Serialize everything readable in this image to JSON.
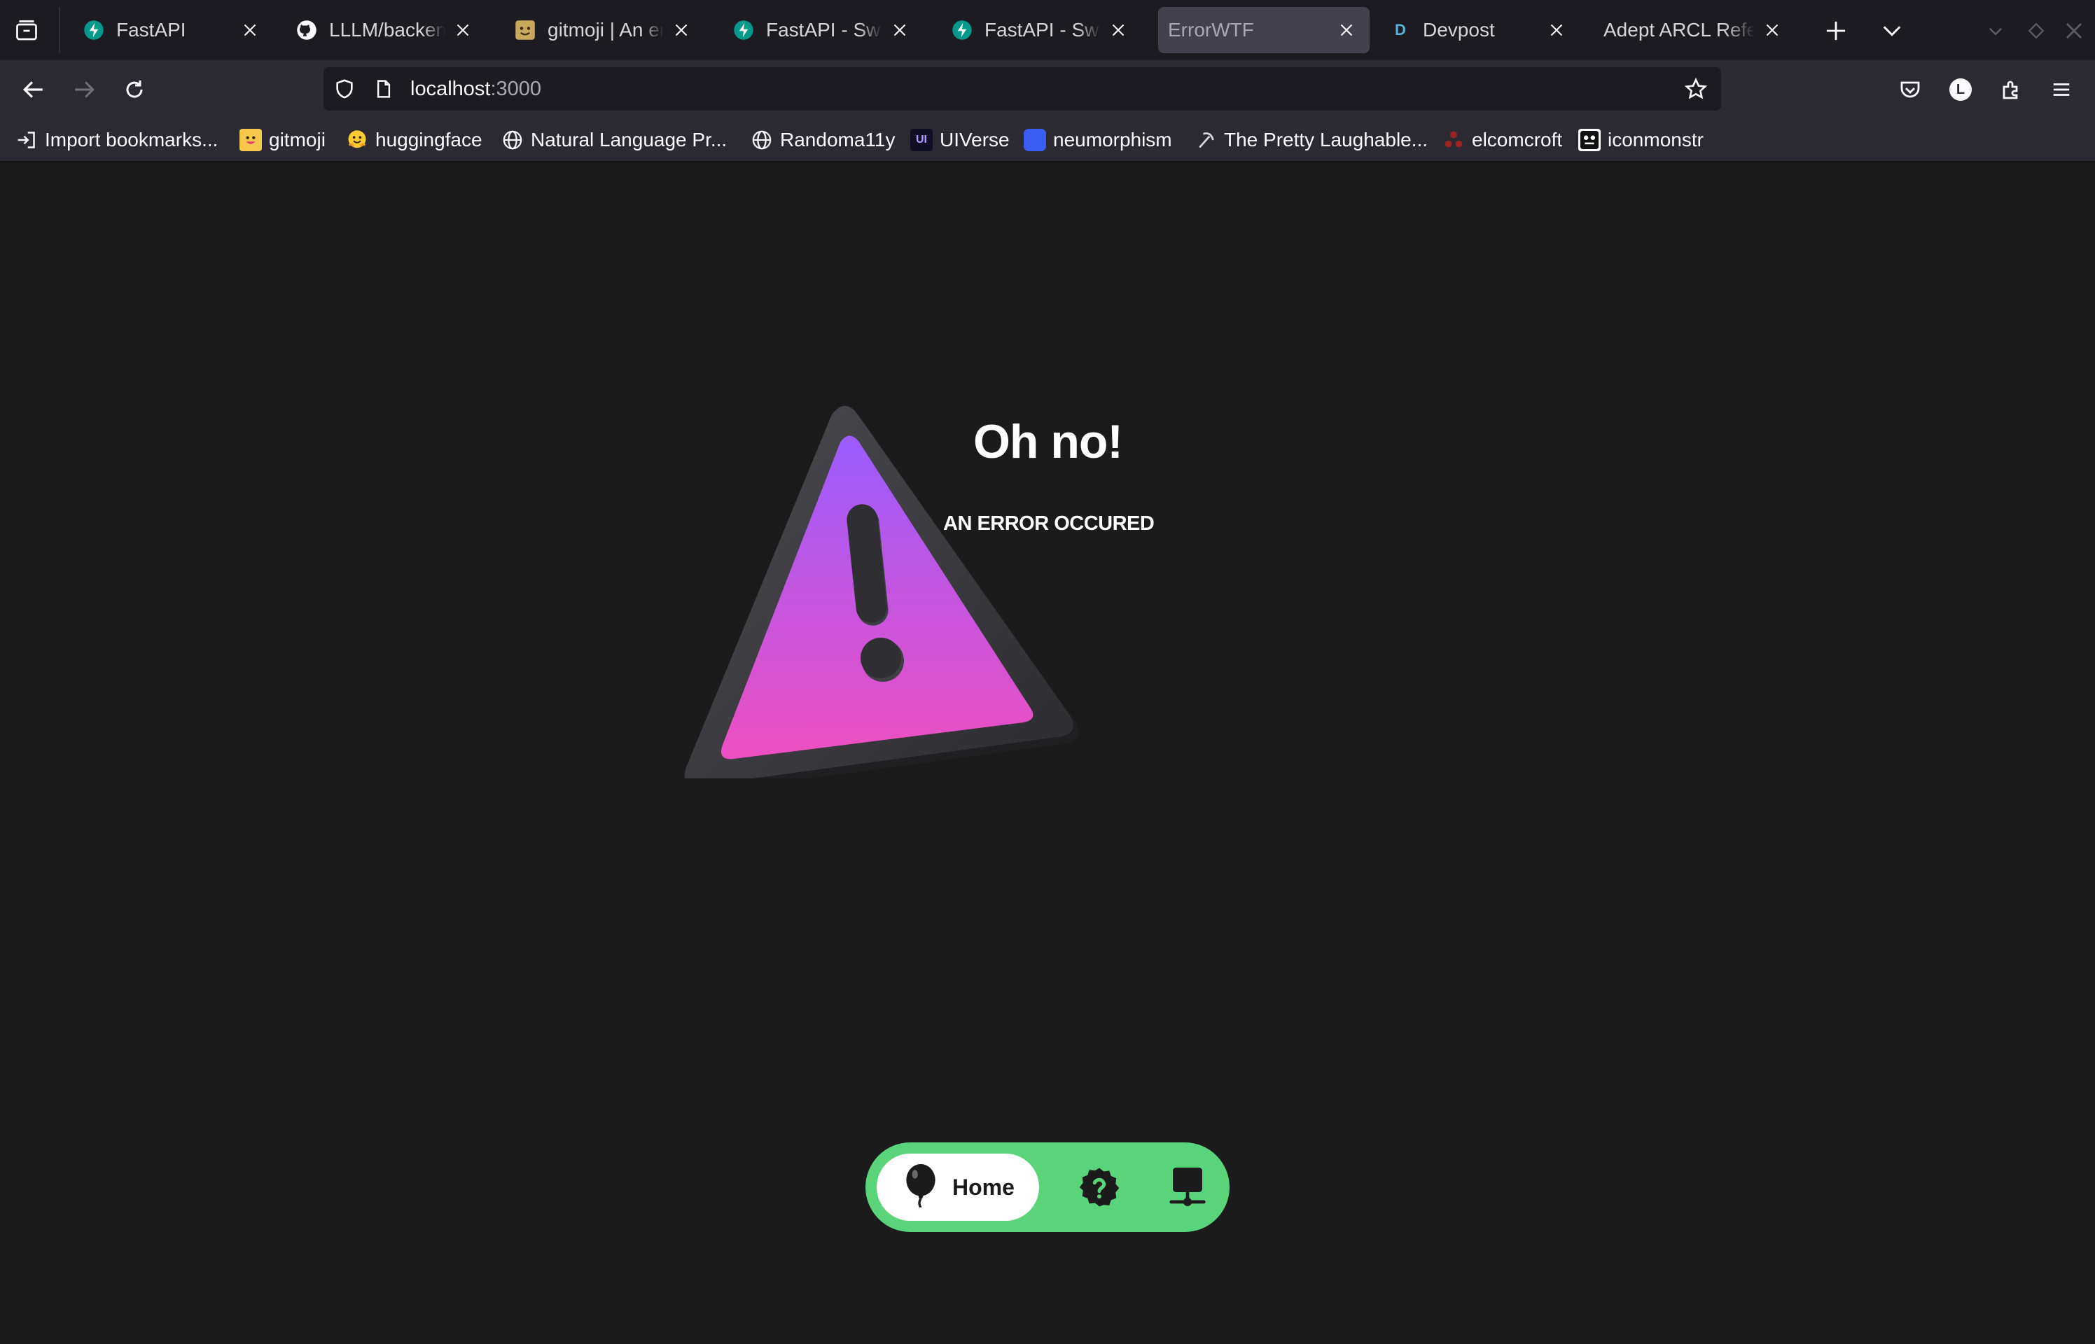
{
  "browser": {
    "tabs": [
      {
        "title": "FastAPI",
        "favicon": "fastapi-icon",
        "active": false
      },
      {
        "title": "LLLM/backend at main",
        "favicon": "github-icon",
        "active": false
      },
      {
        "title": "gitmoji | An emoji guide",
        "favicon": "gitmoji-icon",
        "active": false
      },
      {
        "title": "FastAPI - Swagger UI",
        "favicon": "fastapi-icon",
        "active": false
      },
      {
        "title": "FastAPI - Swagger UI",
        "favicon": "fastapi-icon",
        "active": false
      },
      {
        "title": "ErrorWTF",
        "favicon": "",
        "active": true
      },
      {
        "title": "Devpost",
        "favicon": "devpost-icon",
        "active": false
      },
      {
        "title": "Adept ARCL Reference",
        "favicon": "",
        "active": false
      }
    ],
    "url": {
      "host": "localhost",
      "port": ":3000"
    },
    "bookmarks": [
      {
        "label": "Import bookmarks...",
        "icon": "import-icon"
      },
      {
        "label": "gitmoji",
        "icon": "gitmoji-icon"
      },
      {
        "label": "huggingface",
        "icon": "huggingface-icon"
      },
      {
        "label": "Natural Language Pr...",
        "icon": "globe-icon"
      },
      {
        "label": "Randoma11y",
        "icon": "globe-icon"
      },
      {
        "label": "UIVerse",
        "icon": "uiverse-icon"
      },
      {
        "label": "neumorphism",
        "icon": "neumorphism-icon"
      },
      {
        "label": "The Pretty Laughable...",
        "icon": "pickaxe-icon"
      },
      {
        "label": "elcomcroft",
        "icon": "elcomcroft-icon"
      },
      {
        "label": "iconmonstr",
        "icon": "iconmonstr-icon"
      }
    ],
    "profile_initial": "L",
    "devpost_letter": "D",
    "uiverse_letters": "UI"
  },
  "page": {
    "heading": "Oh no!",
    "subheading": "AN ERROR OCCURED",
    "nav": {
      "home_label": "Home"
    },
    "colors": {
      "background": "#1b1b1b",
      "nav_green": "#59d47a",
      "triangle_top": "#9b5cff",
      "triangle_bottom": "#ee4fc0",
      "triangle_frame": "#3a3a3e"
    }
  }
}
